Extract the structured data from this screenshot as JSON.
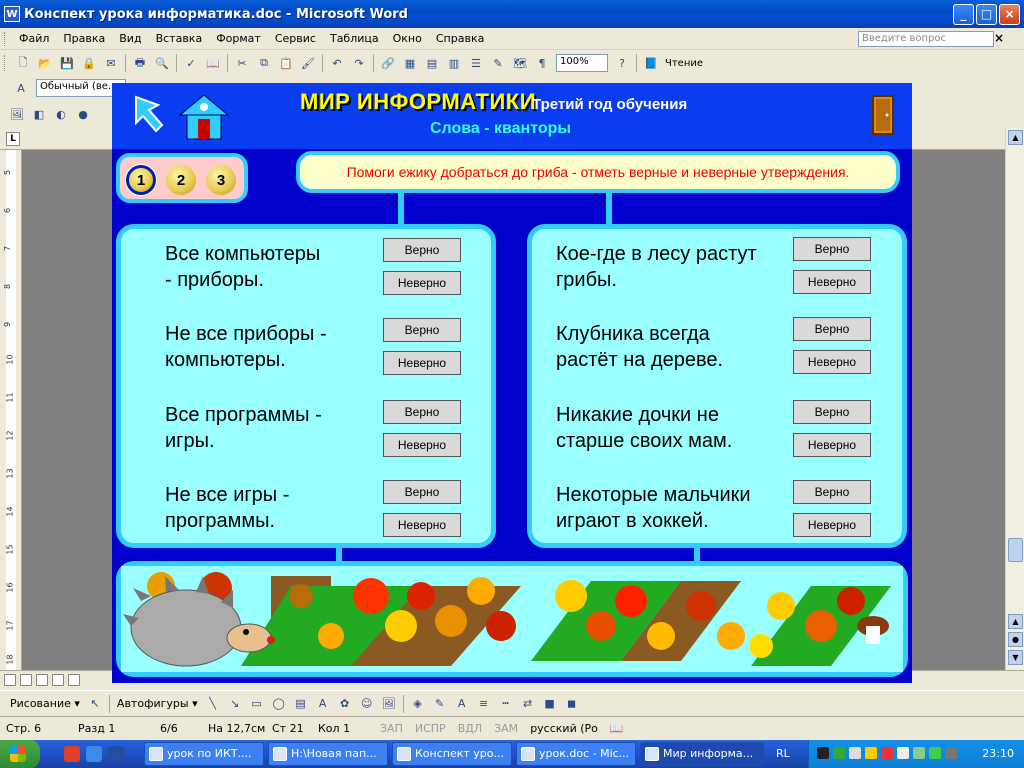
{
  "window": {
    "title": "Конспект урока информатика.doc - Microsoft Word",
    "app_icon": "W",
    "minimize": "_",
    "maximize": "□",
    "close": "×"
  },
  "menu": {
    "items": [
      "Файл",
      "Правка",
      "Вид",
      "Вставка",
      "Формат",
      "Сервис",
      "Таблица",
      "Окно",
      "Справка"
    ],
    "question_placeholder": "Введите вопрос",
    "question_close": "×"
  },
  "toolbar": {
    "zoom": "100%",
    "read_label": "Чтение",
    "style_value": "Обычный (ве..."
  },
  "slide": {
    "title": "МИР ИНФОРМАТИКИ",
    "year": "Третий год обучения",
    "subtitle": "Слова - кванторы",
    "numbers": [
      "1",
      "2",
      "3"
    ],
    "instruction": "Помоги ежику добраться до гриба - отметь верные и неверные утверждения.",
    "true_label": "Верно",
    "false_label": "Неверно",
    "left": [
      {
        "l1": "Все компьютеры",
        "l2": "- приборы."
      },
      {
        "l1": "Не все приборы -",
        "l2": "компьютеры."
      },
      {
        "l1": "Все программы -",
        "l2": "игры."
      },
      {
        "l1": "Не все игры -",
        "l2": "программы."
      }
    ],
    "right": [
      {
        "l1": "Кое-где в лесу растут",
        "l2": "грибы."
      },
      {
        "l1": "Клубника всегда",
        "l2": "растёт на дереве."
      },
      {
        "l1": "Никакие дочки  не",
        "l2": "старше своих мам."
      },
      {
        "l1": "Некоторые мальчики",
        "l2": "играют в хоккей."
      }
    ]
  },
  "drawing": {
    "drawing_label": "Рисование ▾",
    "autoshapes_label": "Автофигуры ▾"
  },
  "status": {
    "page": "Стр. 6",
    "section": "Разд 1",
    "pages": "6/6",
    "at": "На 12,7см",
    "line": "Ст 21",
    "col": "Кол 1",
    "rec": "ЗАП",
    "trk": "ИСПР",
    "ext": "ВДЛ",
    "ovr": "ЗАМ",
    "lang": "русский (Ро"
  },
  "taskbar": {
    "tasks": [
      "урок по ИКТ....",
      "H:\\Новая пап...",
      "Конспект уро...",
      "урок.doc - Mic...",
      "Мир информа..."
    ],
    "lang": "RL",
    "clock": "23:10"
  },
  "ruler_numbers": [
    "5",
    "6",
    "7",
    "8",
    "9",
    "10",
    "11",
    "12",
    "13",
    "14",
    "15",
    "16",
    "17",
    "18"
  ]
}
